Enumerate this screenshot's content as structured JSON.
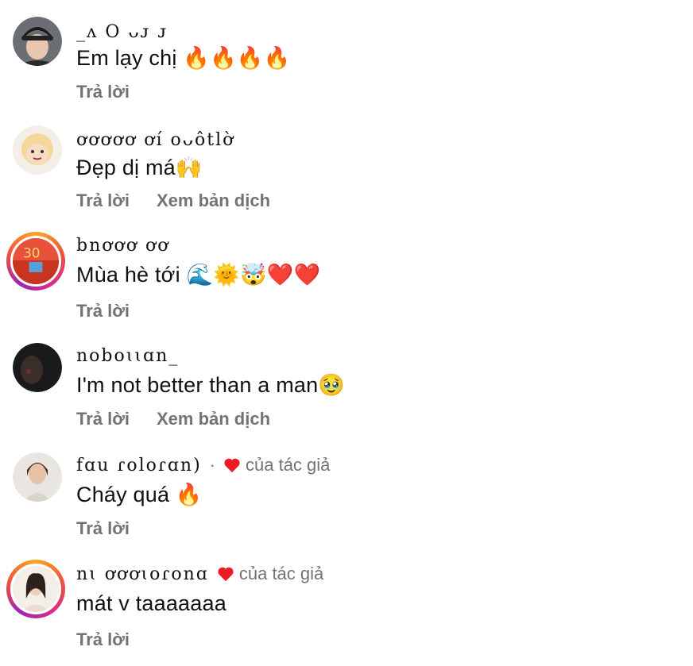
{
  "comments": [
    {
      "username": "_ᴧ O ᴗᴊ ᴊ",
      "text": "Em lạy chị 🔥🔥🔥🔥",
      "actions": {
        "reply": "Trả lời"
      }
    },
    {
      "username": "ơơơơơ ơí oᴗôtlờ",
      "text": "Đẹp dị má🙌",
      "actions": {
        "reply": "Trả lời",
        "translate": "Xem bản dịch"
      }
    },
    {
      "username": "bnơơơ ơơ",
      "text": "Mùa hè tới 🌊🌞🤯❤️❤️",
      "actions": {
        "reply": "Trả lời"
      }
    },
    {
      "username": "noboɩɩɑn_",
      "text": "I'm not better than a man🥹",
      "actions": {
        "reply": "Trả lời",
        "translate": "Xem bản dịch"
      }
    },
    {
      "username": "fɑu ɾoloɾɑn)",
      "separator": "·",
      "author_liked": "của tác giả",
      "text": "Cháy quá 🔥",
      "actions": {
        "reply": "Trả lời"
      }
    },
    {
      "username": "nɩ ơơơɩoɾonɑ",
      "author_liked": "của tác giả",
      "text": "mát v taaaaaaa",
      "actions": {
        "reply": "Trả lời"
      }
    }
  ],
  "colors": {
    "secondary_text": "#737373",
    "heart": "#ed1c24",
    "story_ring": [
      "#f9a825",
      "#d62d8a"
    ]
  }
}
